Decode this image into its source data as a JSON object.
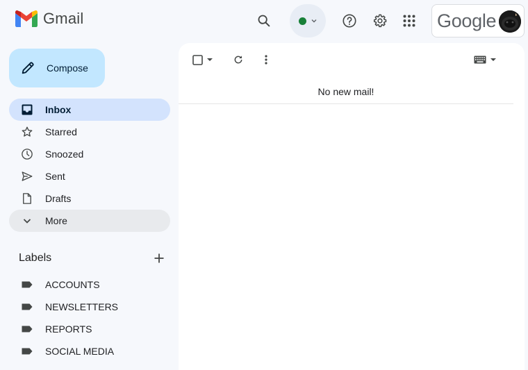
{
  "app": {
    "name": "Gmail"
  },
  "header": {
    "status_color": "#188038",
    "account_brand": "Google",
    "icons": [
      "search-icon",
      "help-icon",
      "settings-icon",
      "apps-grid-icon"
    ]
  },
  "sidebar": {
    "compose_label": "Compose",
    "nav": [
      {
        "label": "Inbox",
        "icon": "inbox-icon",
        "active": true
      },
      {
        "label": "Starred",
        "icon": "star-icon"
      },
      {
        "label": "Snoozed",
        "icon": "clock-icon"
      },
      {
        "label": "Sent",
        "icon": "send-icon"
      },
      {
        "label": "Drafts",
        "icon": "draft-icon"
      },
      {
        "label": "More",
        "icon": "chevron-down-icon"
      }
    ],
    "labels_title": "Labels",
    "labels": [
      "ACCOUNTS",
      "NEWSLETTERS",
      "REPORTS",
      "SOCIAL MEDIA"
    ]
  },
  "main": {
    "empty_message": "No new mail!"
  },
  "colors": {
    "background": "#f6f8fc",
    "compose": "#c2e7ff",
    "active_nav": "#d3e3fd",
    "status_pill": "#e8edf5"
  }
}
